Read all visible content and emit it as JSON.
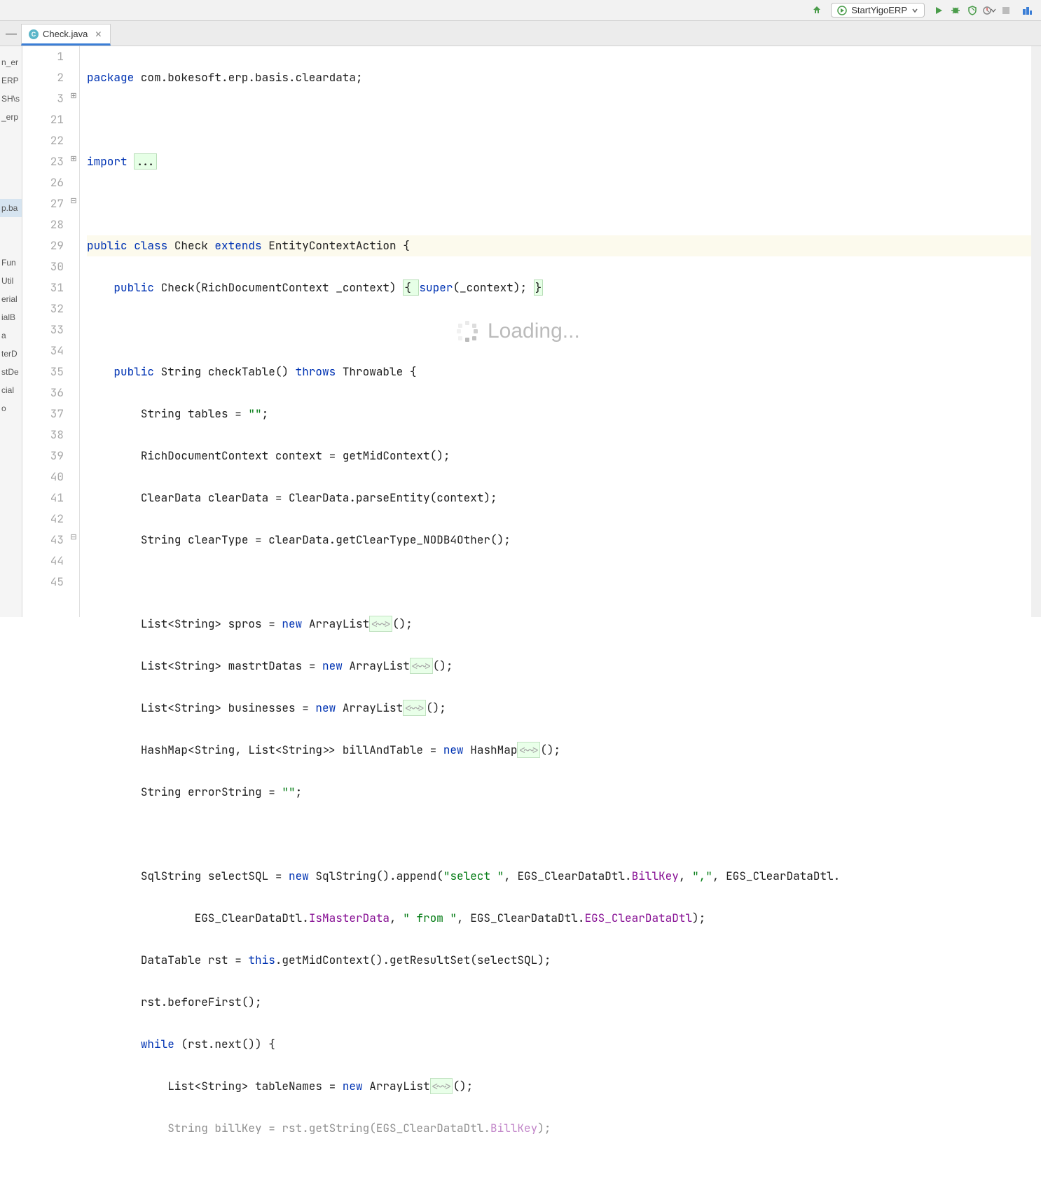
{
  "toolbar": {
    "run_config_label": "StartYigoERP"
  },
  "tab": {
    "filename": "Check.java"
  },
  "sidebar": {
    "items": [
      "n_er",
      "ERP",
      "SH\\s",
      "_erp",
      "",
      "",
      "",
      "",
      "p.ba",
      "",
      "",
      "Fun",
      "Util",
      "erial",
      "ialB",
      "a",
      "terD",
      "stDe",
      "cial",
      "o"
    ]
  },
  "gutter": {
    "lines": [
      "1",
      "2",
      "3",
      "21",
      "22",
      "23",
      "26",
      "27",
      "28",
      "29",
      "30",
      "31",
      "32",
      "33",
      "34",
      "35",
      "36",
      "37",
      "38",
      "39",
      "40",
      "41",
      "42",
      "43",
      "44",
      "45"
    ]
  },
  "code": {
    "l1_kw": "package",
    "l1_rest": " com.bokesoft.erp.basis.cleardata;",
    "l3_kw": "import",
    "l3_rest": "...",
    "l22_pub": "public class",
    "l22_name": "Check ",
    "l22_ext": "extends",
    "l22_sup": " EntityContextAction {",
    "l23_pub": "public",
    "l23_ctor": " Check(RichDocumentContext _context) ",
    "l23_brace_open": "{ ",
    "l23_super": "super",
    "l23_rest": "(_context); ",
    "l23_brace_close": "}",
    "l27_pub": "public",
    "l27_sig1": " String checkTable() ",
    "l27_throws": "throws",
    "l27_sig2": " Throwable {",
    "l28": "String tables = ",
    "l28_str": "\"\"",
    "l28_end": ";",
    "l29": "RichDocumentContext context = getMidContext();",
    "l30": "ClearData clearData = ClearData.parseEntity(context);",
    "l31": "String clearType = clearData.getClearType_NODB4Other();",
    "l33a": "List<String> spros = ",
    "l33_new": "new",
    "l33b": " ArrayList",
    "l33_hint": "<~>",
    "l33c": "();",
    "l34a": "List<String> mastrtDatas = ",
    "l34b": " ArrayList",
    "l35a": "List<String> businesses = ",
    "l35b": " ArrayList",
    "l36a": "HashMap<String, List<String>> billAndTable = ",
    "l36b": " HashMap",
    "l37a": "String errorString = ",
    "l37_str": "\"\"",
    "l37_end": ";",
    "l39a": "SqlString selectSQL = ",
    "l39b": " SqlString().append(",
    "l39_str1": "\"select \"",
    "l39c": ", EGS_ClearDataDtl.",
    "l39_fld1": "BillKey",
    "l39d": ", ",
    "l39_str2": "\",\"",
    "l39e": ", EGS_ClearDataDtl.",
    "l40a": "EGS_ClearDataDtl.",
    "l40_fld": "IsMasterData",
    "l40b": ", ",
    "l40_str": "\" from \"",
    "l40c": ", EGS_ClearDataDtl.",
    "l40_fld2": "EGS_ClearDataDtl",
    "l40d": ");",
    "l41a": "DataTable rst = ",
    "l41_this": "this",
    "l41b": ".getMidContext().getResultSet(selectSQL);",
    "l42": "rst.beforeFirst();",
    "l43_kw": "while",
    "l43_rest": " (rst.next()) {",
    "l44a": "List<String> tableNames = ",
    "l44b": " ArrayList",
    "l45a": "String billKey = rst.getString(EGS_ClearDataDtl.",
    "l45_fld": "BillKey",
    "l45b": ");"
  },
  "loading": "Loading..."
}
